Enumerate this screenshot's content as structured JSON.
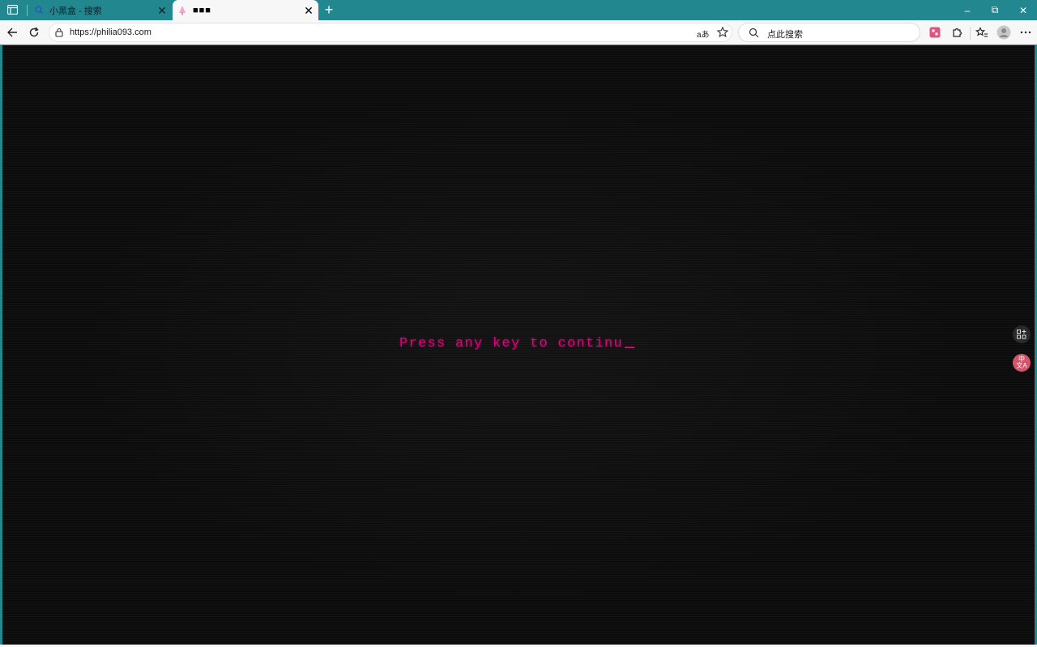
{
  "browser": {
    "tabs": [
      {
        "title": "小黑盒 - 搜索",
        "active": false,
        "favicon": "search-icon"
      },
      {
        "title": "■■■",
        "active": true,
        "favicon": "pink-tree-icon"
      }
    ],
    "new_tab_label": "+",
    "window_controls": {
      "minimize": "–",
      "restore": "⧉",
      "close": "✕"
    },
    "url": "https://philia093.com",
    "read_aloud_label": "aあ",
    "search_placeholder": "点此搜索"
  },
  "page": {
    "prompt_text": "Press any key to continu",
    "background_color": "#0c0c0c",
    "text_color": "#e0007b"
  },
  "side_panel": {
    "translate_label": "中文A"
  },
  "colors": {
    "tabstrip": "#22878e",
    "toolbar": "#f7f7f7",
    "accent_pink": "#e0007b"
  }
}
